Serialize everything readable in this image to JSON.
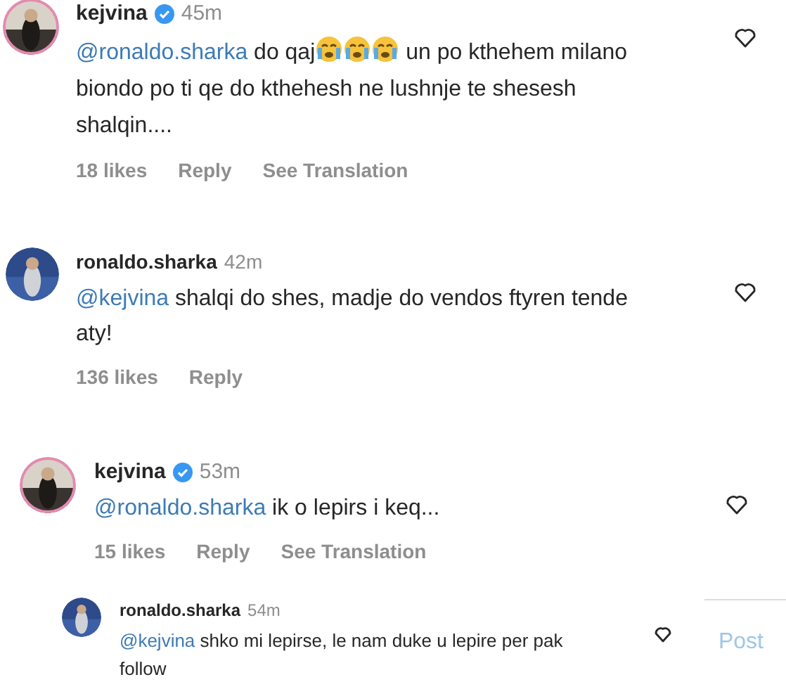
{
  "comments": [
    {
      "kind": "comment",
      "username": "kejvina",
      "verified": true,
      "time": "45m",
      "liked": false,
      "body": [
        {
          "kind": "mention",
          "text": "@ronaldo.sharka"
        },
        {
          "kind": "text",
          "text": " do qaj"
        },
        {
          "kind": "emoji"
        },
        {
          "kind": "emoji"
        },
        {
          "kind": "emoji"
        },
        {
          "kind": "text",
          "text": " un po kthehem milano biondo po ti qe do kthehesh ne lushnje te shesesh shalqin...."
        }
      ],
      "meta": [
        "18 likes",
        "Reply",
        "See Translation"
      ]
    },
    {
      "kind": "comment",
      "username": "ronaldo.sharka",
      "verified": false,
      "time": "42m",
      "liked": false,
      "body": [
        {
          "kind": "mention",
          "text": "@kejvina"
        },
        {
          "kind": "text",
          "text": " shalqi do shes, madje do vendos ftyren tende aty!"
        }
      ],
      "meta": [
        "136 likes",
        "Reply"
      ]
    },
    {
      "kind": "comment",
      "username": "kejvina",
      "verified": true,
      "time": "53m",
      "liked": false,
      "body": [
        {
          "kind": "mention",
          "text": "@ronaldo.sharka"
        },
        {
          "kind": "text",
          "text": " ik o lepirs i keq..."
        }
      ],
      "meta": [
        "15 likes",
        "Reply",
        "See Translation"
      ]
    },
    {
      "kind": "reply",
      "username": "ronaldo.sharka",
      "verified": false,
      "time": "54m",
      "liked": false,
      "body": [
        {
          "kind": "mention",
          "text": "@kejvina"
        },
        {
          "kind": "text",
          "text": " shko mi lepirse, le nam duke u lepire per pak follow"
        }
      ]
    }
  ],
  "post_button": "Post"
}
